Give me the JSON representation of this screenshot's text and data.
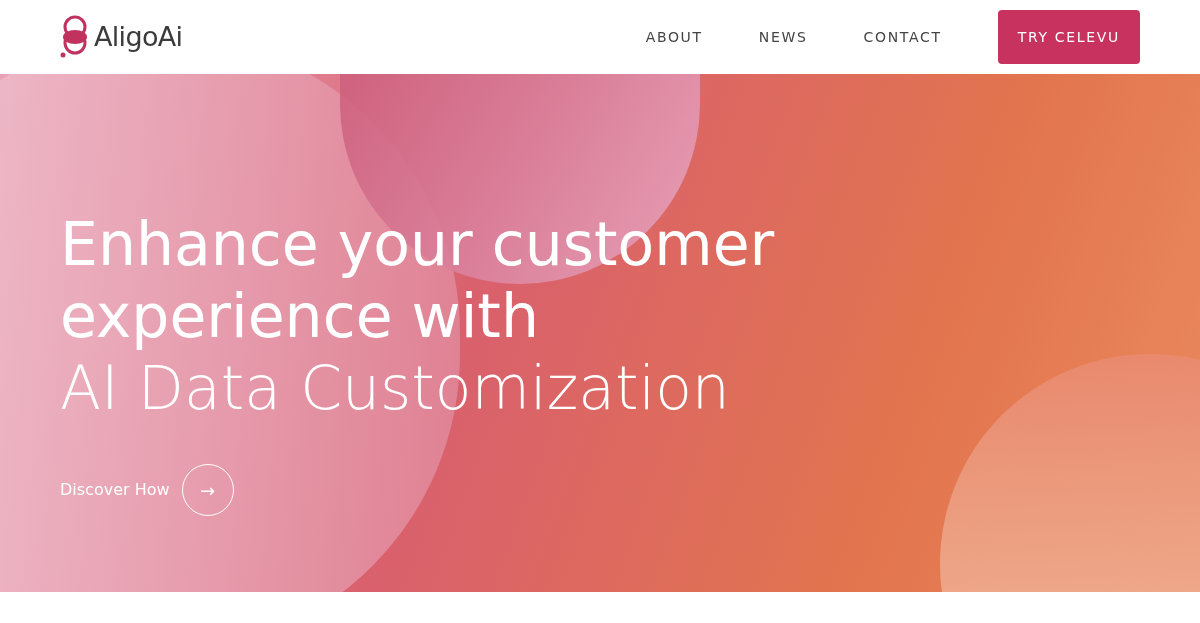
{
  "header": {
    "logo": "AligoAi",
    "nav": [
      "ABOUT",
      "NEWS",
      "CONTACT"
    ],
    "cta": "TRY CELEVU"
  },
  "hero": {
    "headline_lines": [
      "Enhance your customer",
      "experience with"
    ],
    "subline": "AI Data Customization",
    "discover": {
      "label": "Discover How",
      "arrow": "→"
    }
  }
}
